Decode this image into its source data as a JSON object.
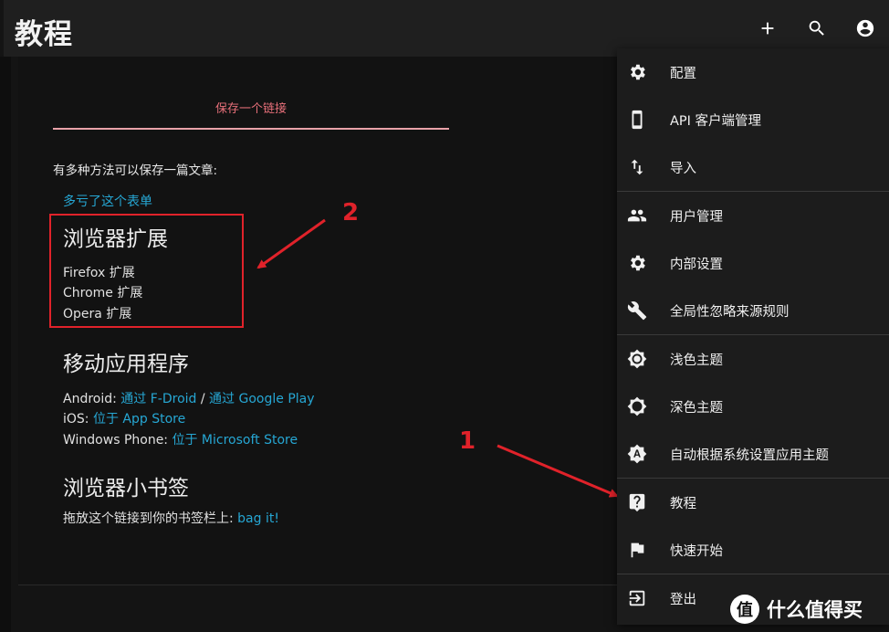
{
  "app": {
    "title": "教程"
  },
  "topbar": {
    "add_icon": "plus-icon",
    "search_icon": "search-icon",
    "account_icon": "account-circle-icon"
  },
  "tutorial": {
    "tab_label": "保存一个链接",
    "intro": "有多种方法可以保存一篇文章:",
    "form_link": "多亏了这个表单",
    "browser_ext": {
      "heading": "浏览器扩展",
      "links": [
        "Firefox 扩展",
        "Chrome 扩展",
        "Opera 扩展"
      ]
    },
    "mobile": {
      "heading": "移动应用程序",
      "android_label": "Android: ",
      "android_fdroid": "通过 F-Droid",
      "android_sep": " / ",
      "android_gplay": "通过 Google Play",
      "ios_label": "iOS: ",
      "ios_link": "位于 App Store",
      "wp_label": "Windows Phone: ",
      "wp_link": "位于 Microsoft Store"
    },
    "bookmarklet": {
      "heading": "浏览器小书签",
      "text": "拖放这个链接到你的书签栏上:",
      "link": "bag it!"
    }
  },
  "menu": {
    "items": [
      {
        "label": "配置",
        "icon": "gear-icon"
      },
      {
        "label": "API 客户端管理",
        "icon": "phone-icon"
      },
      {
        "label": "导入",
        "icon": "import-arrows-icon"
      },
      {
        "label": "用户管理",
        "icon": "people-icon"
      },
      {
        "label": "内部设置",
        "icon": "gear-icon"
      },
      {
        "label": "全局性忽略来源规则",
        "icon": "wrench-icon"
      },
      {
        "label": "浅色主题",
        "icon": "brightness-light-icon"
      },
      {
        "label": "深色主题",
        "icon": "brightness-dark-icon"
      },
      {
        "label": "自动根据系统设置应用主题",
        "icon": "brightness-auto-icon"
      },
      {
        "label": "教程",
        "icon": "help-icon"
      },
      {
        "label": "快速开始",
        "icon": "flag-icon"
      },
      {
        "label": "登出",
        "icon": "logout-icon"
      }
    ]
  },
  "annotations": {
    "num1": "1",
    "num2": "2",
    "color": "#e0222a"
  },
  "watermark": {
    "logo_char": "值",
    "text": "什么值得买"
  },
  "colors": {
    "accent_link": "#26a7d4",
    "tab_active": "#e8707a",
    "background": "#141414"
  }
}
